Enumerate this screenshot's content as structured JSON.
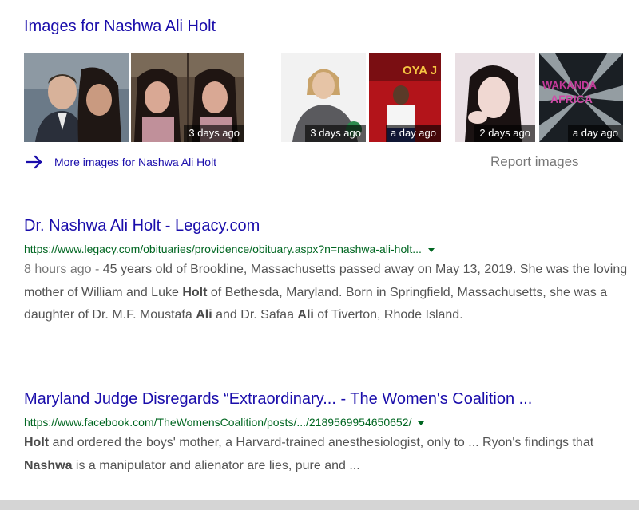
{
  "images": {
    "heading": "Images for Nashwa Ali Holt",
    "thumbnails": [
      {
        "alt": "photo-1",
        "badge": ""
      },
      {
        "alt": "photo-2",
        "badge": "3 days ago"
      },
      {
        "alt": "photo-3",
        "badge": "3 days ago"
      },
      {
        "alt": "photo-4",
        "badge": "a day ago"
      },
      {
        "alt": "photo-5",
        "badge": "2 days ago"
      },
      {
        "alt": "photo-6",
        "badge": "a day ago"
      }
    ],
    "thumb6_overlay_text_1": "WAKANDA",
    "thumb6_overlay_text_2": "AFRICA",
    "thumb4_sign_text": "OYA J",
    "more_label": "More images for Nashwa Ali Holt",
    "report_label": "Report images"
  },
  "results": [
    {
      "title": "Dr. Nashwa Ali Holt - Legacy.com",
      "url": "https://www.legacy.com/obituaries/providence/obituary.aspx?n=nashwa-ali-holt...",
      "snippet_parts": [
        {
          "t": "8 hours ago - ",
          "style": "date"
        },
        {
          "t": "45 years old of Brookline, Massachusetts passed away on May 13, 2019. She was the loving mother of William and Luke ",
          "style": "normal"
        },
        {
          "t": "Holt",
          "style": "bold"
        },
        {
          "t": " of Bethesda, Maryland. Born in Springfield, Massachusetts, she was a daughter of Dr. M.F. Moustafa ",
          "style": "normal"
        },
        {
          "t": "Ali",
          "style": "bold"
        },
        {
          "t": " and Dr. Safaa ",
          "style": "normal"
        },
        {
          "t": "Ali",
          "style": "bold"
        },
        {
          "t": " of Tiverton, Rhode Island.",
          "style": "normal"
        }
      ]
    },
    {
      "title": "Maryland Judge Disregards “Extraordinary... - The Women's Coalition ...",
      "url": "https://www.facebook.com/TheWomensCoalition/posts/.../2189569954650652/",
      "snippet_parts": [
        {
          "t": "Holt",
          "style": "bold"
        },
        {
          "t": " and ordered the boys' mother, a Harvard-trained anesthesiologist, only to ... Ryon's findings that ",
          "style": "normal"
        },
        {
          "t": "Nashwa",
          "style": "bold"
        },
        {
          "t": " is a manipulator and alienator are lies, pure and ...",
          "style": "normal"
        }
      ]
    }
  ],
  "colors": {
    "link": "#1a0dab",
    "url": "#006621",
    "snippet": "#545454",
    "muted": "#777777"
  }
}
